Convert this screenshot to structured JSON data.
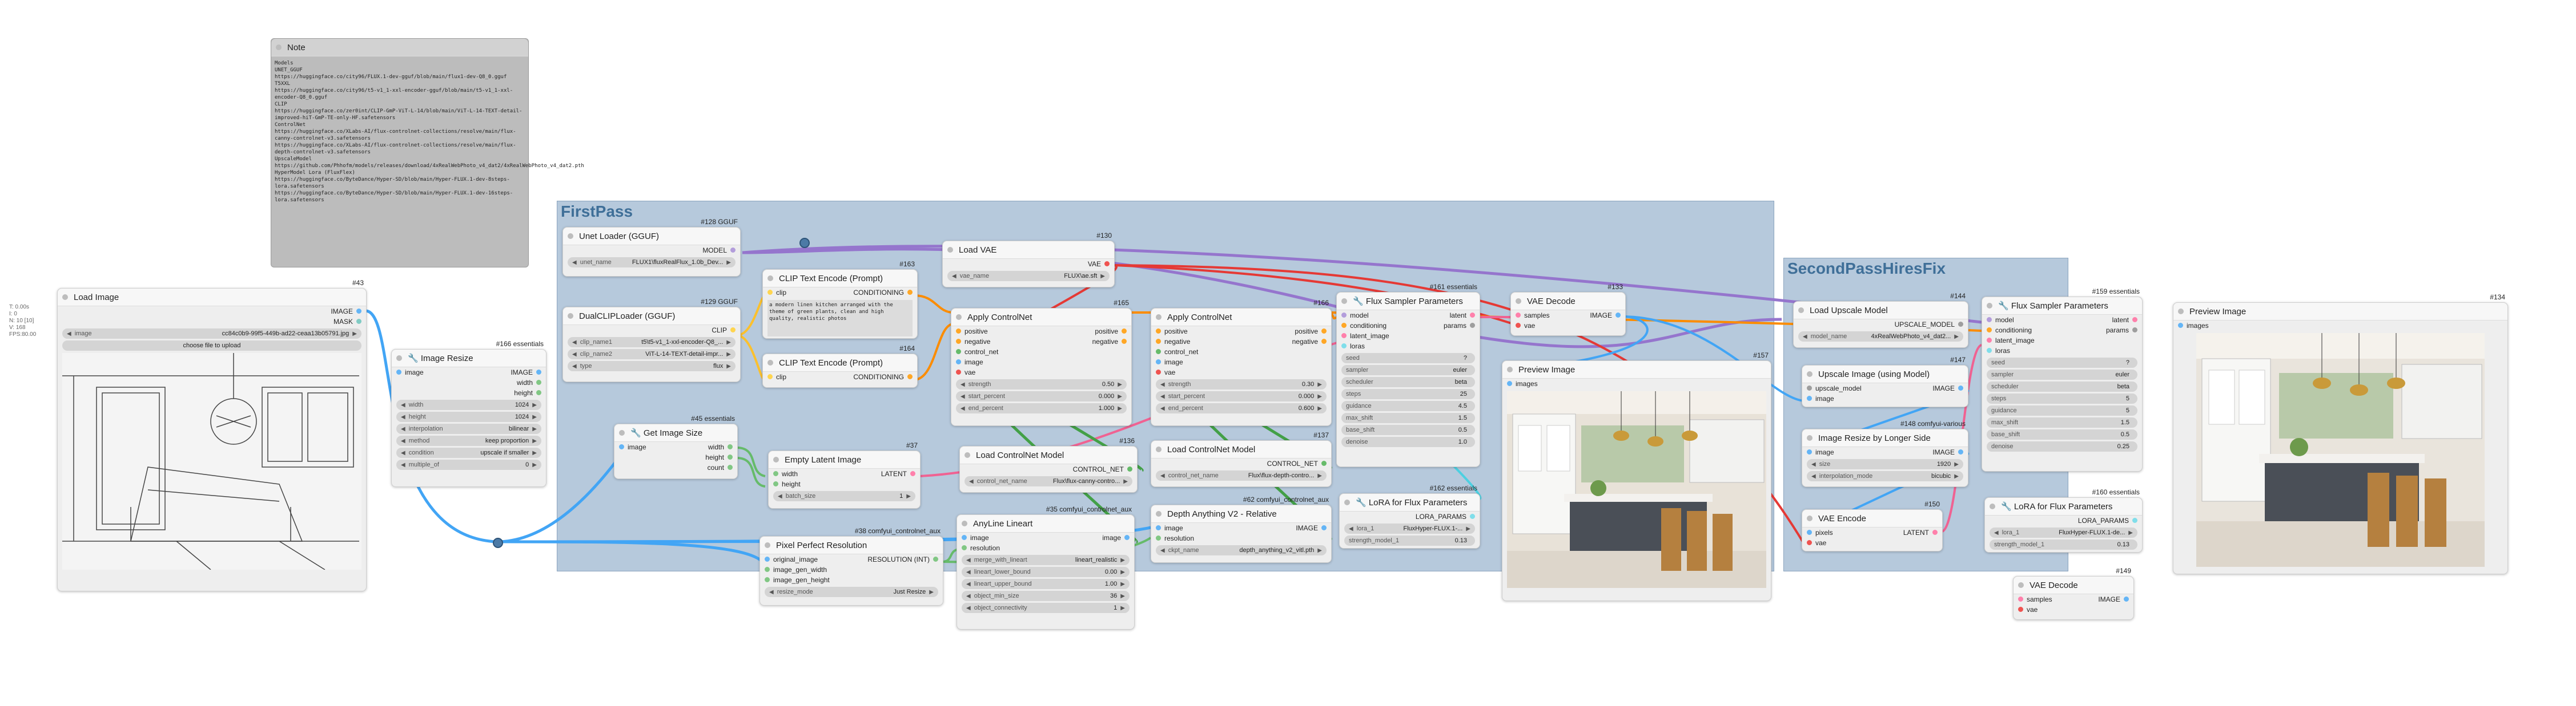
{
  "colors": {
    "model": "#b39ddb",
    "clip": "#ffd54f",
    "vae": "#ef5350",
    "image": "#64b5f6",
    "latent": "#ff80ab",
    "conditioning": "#ffa726",
    "control_net": "#66bb6a",
    "int": "#81c784",
    "upscale_model": "#9e9e9e",
    "lora": "#80deea"
  },
  "groups": {
    "firstpass": "FirstPass",
    "secondpass": "SecondPassHiresFix"
  },
  "stray": {
    "text": "T: 0.00s\nI: 0\nN: 10 [10]\nV: 168\nFPS:80.00"
  },
  "note": {
    "title": "Note",
    "text": "Models\nUNET_GGUF\nhttps://huggingface.co/city96/FLUX.1-dev-gguf/blob/main/flux1-dev-Q8_0.gguf\nT5XXL\nhttps://huggingface.co/city96/t5-v1_1-xxl-encoder-gguf/blob/main/t5-v1_1-xxl-encoder-Q8_0.gguf\nCLIP\nhttps://huggingface.co/zer0int/CLIP-GmP-ViT-L-14/blob/main/ViT-L-14-TEXT-detail-improved-hiT-GmP-TE-only-HF.safetensors\nControlNet\nhttps://huggingface.co/XLabs-AI/flux-controlnet-collections/resolve/main/flux-canny-controlnet-v3.safetensors\nhttps://huggingface.co/XLabs-AI/flux-controlnet-collections/resolve/main/flux-depth-controlnet-v3.safetensors\nUpscaleModel\nhttps://github.com/Phhofm/models/releases/download/4xRealWebPhoto_v4_dat2/4xRealWebPhoto_v4_dat2.pth\nHyperModel Lora (FluxFlex)\nhttps://huggingface.co/ByteDance/Hyper-SD/blob/main/Hyper-FLUX.1-dev-8steps-lora.safetensors\nhttps://huggingface.co/ByteDance/Hyper-SD/blob/main/Hyper-FLUX.1-dev-16steps-lora.safetensors"
  },
  "load_image": {
    "badge": "#43",
    "title": "Load Image",
    "out1": "IMAGE",
    "out2": "MASK",
    "image_label": "image",
    "image_value": "cc84c0b9-99f5-449b-ad22-ceaa13b05791.jpg",
    "upload": "choose file to upload"
  },
  "image_resize": {
    "badge": "#166 essentials",
    "title": "🔧 Image Resize",
    "in1": "image",
    "out1": "IMAGE",
    "out2": "width",
    "out3": "height",
    "w": [
      {
        "k": "width",
        "v": "1024"
      },
      {
        "k": "height",
        "v": "1024"
      },
      {
        "k": "interpolation",
        "v": "bilinear"
      },
      {
        "k": "method",
        "v": "keep proportion"
      },
      {
        "k": "condition",
        "v": "upscale if smaller"
      },
      {
        "k": "multiple_of",
        "v": "0"
      }
    ]
  },
  "unet_loader": {
    "badge": "#128 GGUF",
    "title": "Unet Loader (GGUF)",
    "out1": "MODEL",
    "w": [
      {
        "k": "unet_name",
        "v": "FLUX1\\fluxRealFlux_1.0b_Dev..."
      }
    ]
  },
  "dual_clip": {
    "badge": "#129 GGUF",
    "title": "DualCLIPLoader (GGUF)",
    "out1": "CLIP",
    "w": [
      {
        "k": "clip_name1",
        "v": "t5\\t5-v1_1-xxl-encoder-Q8_..."
      },
      {
        "k": "clip_name2",
        "v": "ViT-L-14-TEXT-detail-impr..."
      },
      {
        "k": "type",
        "v": "flux"
      }
    ]
  },
  "get_image_size": {
    "badge": "#45 essentials",
    "title": "🔧 Get Image Size",
    "in1": "image",
    "out1": "width",
    "out2": "height",
    "out3": "count"
  },
  "clip_text_pos": {
    "badge": "#163",
    "title": "CLIP Text Encode (Prompt)",
    "in1": "clip",
    "out1": "CONDITIONING",
    "text": "a modern linen kitchen arranged with the theme of green plants, clean and high quality, realistic photos"
  },
  "clip_text_neg": {
    "badge": "#164",
    "title": "CLIP Text Encode (Prompt)",
    "in1": "clip",
    "out1": "CONDITIONING"
  },
  "empty_latent": {
    "badge": "#37",
    "title": "Empty Latent Image",
    "in1": "width",
    "in2": "height",
    "out1": "LATENT",
    "w": [
      {
        "k": "batch_size",
        "v": "1"
      }
    ]
  },
  "pixel_perfect": {
    "badge": "#38 comfyui_controlnet_aux",
    "title": "Pixel Perfect Resolution",
    "in1": "original_image",
    "in2": "image_gen_width",
    "in3": "image_gen_height",
    "out1": "RESOLUTION (INT)",
    "w": [
      {
        "k": "resize_mode",
        "v": "Just Resize"
      }
    ]
  },
  "load_vae": {
    "badge": "#130",
    "title": "Load VAE",
    "out1": "VAE",
    "w": [
      {
        "k": "vae_name",
        "v": "FLUX\\ae.sft"
      }
    ]
  },
  "apply_cn1": {
    "badge": "#165",
    "title": "Apply ControlNet",
    "in": [
      "positive",
      "negative",
      "control_net",
      "image",
      "vae"
    ],
    "out": [
      "positive",
      "negative"
    ],
    "w": [
      {
        "k": "strength",
        "v": "0.50"
      },
      {
        "k": "start_percent",
        "v": "0.000"
      },
      {
        "k": "end_percent",
        "v": "1.000"
      }
    ]
  },
  "apply_cn2": {
    "badge": "#166",
    "title": "Apply ControlNet",
    "in": [
      "positive",
      "negative",
      "control_net",
      "image",
      "vae"
    ],
    "out": [
      "positive",
      "negative"
    ],
    "w": [
      {
        "k": "strength",
        "v": "0.30"
      },
      {
        "k": "start_percent",
        "v": "0.000"
      },
      {
        "k": "end_percent",
        "v": "0.600"
      }
    ]
  },
  "load_cn1": {
    "badge": "#136",
    "title": "Load ControlNet Model",
    "out1": "CONTROL_NET",
    "w": [
      {
        "k": "control_net_name",
        "v": "Flux\\flux-canny-contro..."
      }
    ]
  },
  "load_cn2": {
    "badge": "#137",
    "title": "Load ControlNet Model",
    "out1": "CONTROL_NET",
    "w": [
      {
        "k": "control_net_name",
        "v": "Flux\\flux-depth-contro..."
      }
    ]
  },
  "anyline": {
    "badge": "#35 comfyui_controlnet_aux",
    "title": "AnyLine Lineart",
    "in1": "image",
    "in2": "resolution",
    "out1": "image",
    "w": [
      {
        "k": "merge_with_lineart",
        "v": "lineart_realistic"
      },
      {
        "k": "lineart_lower_bound",
        "v": "0.00"
      },
      {
        "k": "lineart_upper_bound",
        "v": "1.00"
      },
      {
        "k": "object_min_size",
        "v": "36"
      },
      {
        "k": "object_connectivity",
        "v": "1"
      }
    ]
  },
  "depth_anything": {
    "badge": "#62 comfyui_controlnet_aux",
    "title": "Depth Anything V2 - Relative",
    "in1": "image",
    "in2": "resolution",
    "out1": "IMAGE",
    "w": [
      {
        "k": "ckpt_name",
        "v": "depth_anything_v2_vitl.pth"
      }
    ]
  },
  "flux_sampler1": {
    "badge": "#161 essentials",
    "title": "🔧 Flux Sampler Parameters",
    "in": [
      "model",
      "conditioning",
      "latent_image",
      "loras"
    ],
    "out": [
      "latent",
      "params"
    ],
    "w": [
      {
        "k": "seed",
        "v": "?"
      },
      {
        "k": "sampler",
        "v": "euler"
      },
      {
        "k": "scheduler",
        "v": "beta"
      },
      {
        "k": "steps",
        "v": "25"
      },
      {
        "k": "guidance",
        "v": "4.5"
      },
      {
        "k": "max_shift",
        "v": "1.5"
      },
      {
        "k": "base_shift",
        "v": "0.5"
      },
      {
        "k": "denoise",
        "v": "1.0"
      }
    ]
  },
  "lora1": {
    "badge": "#162 essentials",
    "title": "🔧 LoRA for Flux Parameters",
    "out1": "LORA_PARAMS",
    "w": [
      {
        "k": "lora_1",
        "v": "FluxHyper-FLUX.1-..."
      },
      {
        "k": "strength_model_1",
        "v": "0.13"
      }
    ]
  },
  "vae_decode1": {
    "badge": "#133",
    "title": "VAE Decode",
    "in1": "samples",
    "in2": "vae",
    "out1": "IMAGE"
  },
  "preview1": {
    "badge": "#157",
    "title": "Preview Image",
    "in1": "images"
  },
  "load_upscale": {
    "badge": "#144",
    "title": "Load Upscale Model",
    "out1": "UPSCALE_MODEL",
    "w": [
      {
        "k": "model_name",
        "v": "4xRealWebPhoto_v4_dat2..."
      }
    ]
  },
  "upscale_with_model": {
    "badge": "#147",
    "title": "Upscale Image (using Model)",
    "in1": "upscale_model",
    "in2": "image",
    "out1": "IMAGE"
  },
  "resize_longer": {
    "badge": "#148 comfyui-various",
    "title": "Image Resize by Longer Side",
    "in1": "image",
    "out1": "IMAGE",
    "w": [
      {
        "k": "size",
        "v": "1920"
      },
      {
        "k": "interpolation_mode",
        "v": "bicubic"
      }
    ]
  },
  "vae_encode": {
    "badge": "#150",
    "title": "VAE Encode",
    "in1": "pixels",
    "in2": "vae",
    "out1": "LATENT"
  },
  "flux_sampler2": {
    "badge": "#159 essentials",
    "title": "🔧 Flux Sampler Parameters",
    "in": [
      "model",
      "conditioning",
      "latent_image",
      "loras"
    ],
    "out": [
      "latent",
      "params"
    ],
    "w": [
      {
        "k": "seed",
        "v": "?"
      },
      {
        "k": "sampler",
        "v": "euler"
      },
      {
        "k": "scheduler",
        "v": "beta"
      },
      {
        "k": "steps",
        "v": "5"
      },
      {
        "k": "guidance",
        "v": "5"
      },
      {
        "k": "max_shift",
        "v": "1.5"
      },
      {
        "k": "base_shift",
        "v": "0.5"
      },
      {
        "k": "denoise",
        "v": "0.25"
      }
    ]
  },
  "lora2": {
    "badge": "#160 essentials",
    "title": "🔧 LoRA for Flux Parameters",
    "out1": "LORA_PARAMS",
    "w": [
      {
        "k": "lora_1",
        "v": "FluxHyper-FLUX.1-de..."
      },
      {
        "k": "strength_model_1",
        "v": "0.13"
      }
    ]
  },
  "vae_decode2": {
    "badge": "#149",
    "title": "VAE Decode",
    "in1": "samples",
    "in2": "vae",
    "out1": "IMAGE"
  },
  "preview2": {
    "badge": "#134",
    "title": "Preview Image",
    "in1": "images"
  }
}
